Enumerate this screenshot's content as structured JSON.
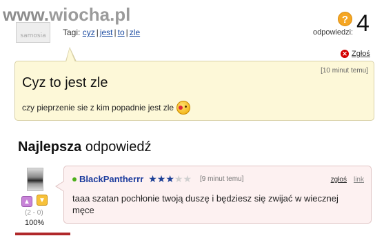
{
  "watermark": {
    "www": "www.",
    "brand": "wiocha",
    "tld": ".pl",
    "dot": "."
  },
  "asker": {
    "avatar_text": "samosia"
  },
  "tags": {
    "label": "Tagi:",
    "items": [
      "cyz",
      "jest",
      "to",
      "zle"
    ]
  },
  "answers": {
    "icon": "?",
    "label": "odpowiedzi:",
    "count": "4"
  },
  "report_top": {
    "label": "Zgłoś"
  },
  "question": {
    "time": "[10 minut temu]",
    "title": "Cyz to jest zle",
    "body": "czy pieprzenie sie z kim popadnie jest zle"
  },
  "best_answer": {
    "heading_bold": "Najlepsza",
    "heading_rest": " odpowiedź",
    "vote_count": "(2 - 0)",
    "percent": "100%",
    "username": "BlackPantherrr",
    "stars": {
      "filled": 3,
      "total": 5
    },
    "time": "[9 minut temu]",
    "report_label": "zgłoś",
    "link_label": "link",
    "body": "taaa szatan pochłonie twoją duszę i będziesz się zwijać w wiecznej męce"
  },
  "colors": {
    "question_bg": "#fdf8d8",
    "answer_bg": "#fdf1f1",
    "username": "#1a3a9c",
    "star_on": "#1c3f95",
    "watermark_red": "#c40000"
  }
}
